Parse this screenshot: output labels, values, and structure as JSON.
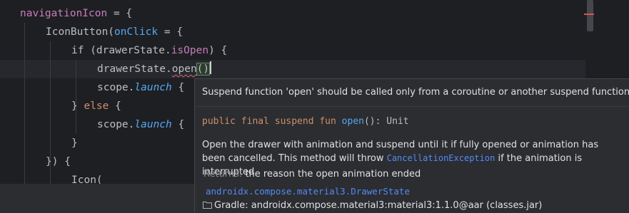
{
  "code": {
    "line1": {
      "name": "navigationIcon",
      "op": " = {"
    },
    "line2": {
      "fn": "IconButton(",
      "named": "onClick",
      "op": " = {"
    },
    "line3": {
      "pre": "if (drawerState.",
      "prop": "isOpen",
      "post": ") {"
    },
    "line4": {
      "pre": "drawerState.",
      "err": "open",
      "paren": "()"
    },
    "line5": {
      "pre": "scope.",
      "italic": "launch",
      "post": " {"
    },
    "line6": {
      "pre": "} ",
      "kw": "else",
      "post": " {"
    },
    "line7": {
      "pre": "scope.",
      "italic": "launch",
      "post": " {"
    },
    "line8": {
      "text": "}"
    },
    "line9": {
      "text": "}) {"
    },
    "line10": {
      "text": "Icon("
    }
  },
  "popup": {
    "error_message": "Suspend function 'open' should be called only from a coroutine or another suspend function",
    "signature": {
      "modifiers": "public final suspend fun ",
      "fn_name": "open",
      "rest": "(): Unit"
    },
    "description_part1": "Open the drawer with animation and suspend until it if fully opened or animation has been cancelled. This method will throw ",
    "description_link": "CancellationException",
    "description_part2": " if the animation is interrupted",
    "returns_label": "Returns:",
    "returns_text": "the reason the open animation ended",
    "class_link": "androidx.compose.material3.DrawerState",
    "gradle_text": "Gradle: androidx.compose.material3:material3:1.1.0@aar (classes.jar)"
  },
  "colors": {
    "editor_bg": "#1e1f22",
    "popup_bg": "#2b2d30",
    "keyword": "#cf8e6d",
    "function": "#56a8f5",
    "property": "#c77dbb",
    "link": "#548af7",
    "error": "#d9534f"
  },
  "icons": [
    "folder-icon"
  ]
}
